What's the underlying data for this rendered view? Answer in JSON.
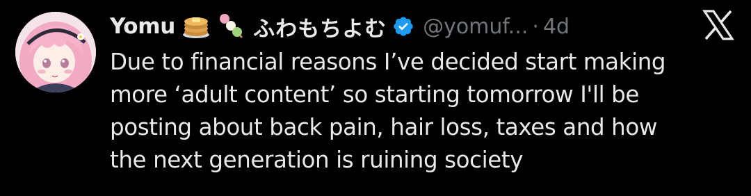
{
  "tweet": {
    "display_name": "Yomu",
    "emoji_1": "pancakes-emoji",
    "emoji_2": "dango-emoji",
    "name_jp": "ふわもちよむ",
    "verified_icon": "verified-badge-icon",
    "handle": "@yomuf...",
    "separator": "·",
    "time": "4d",
    "body_lines": [
      "Due to financial reasons I’ve decided start making",
      "more ‘adult content’ so starting tomorrow I'll be",
      "posting about back pain, hair loss, taxes and how",
      "the next generation is ruining society"
    ]
  },
  "logo": "x-logo-icon",
  "colors": {
    "background": "#000000",
    "primary_text": "#e7e9ea",
    "secondary_text": "#71767b",
    "verified": "#1d9bf0"
  }
}
